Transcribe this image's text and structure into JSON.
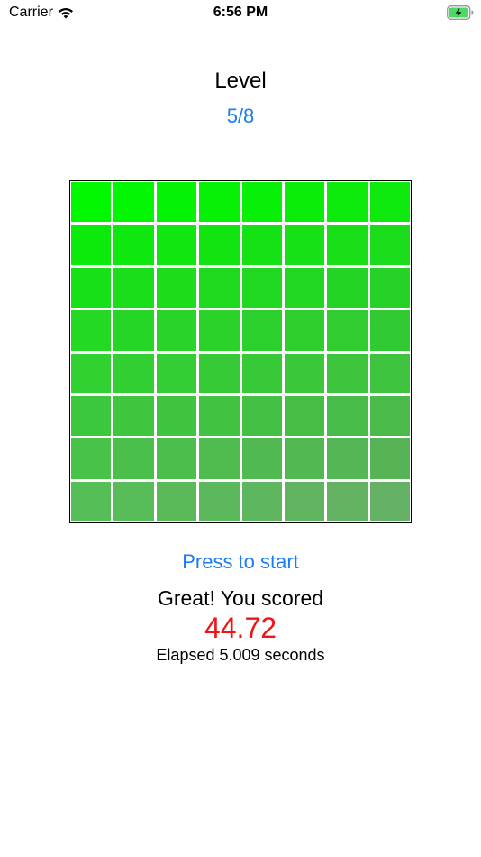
{
  "status_bar": {
    "carrier": "Carrier",
    "time": "6:56 PM",
    "battery_state": "charging"
  },
  "level": {
    "title": "Level",
    "value": "5/8"
  },
  "grid": {
    "rows": 8,
    "cols": 8,
    "colors": [
      [
        "#00f700",
        "#02f502",
        "#04f304",
        "#06f106",
        "#08ef08",
        "#0aed0a",
        "#0ceb0c",
        "#0ee90e"
      ],
      [
        "#0cea0c",
        "#0ee80e",
        "#10e610",
        "#12e412",
        "#14e214",
        "#16e016",
        "#18de18",
        "#1adc1a"
      ],
      [
        "#18e018",
        "#1ade1a",
        "#1cdc1c",
        "#1eda1e",
        "#20d820",
        "#22d622",
        "#24d424",
        "#26d226"
      ],
      [
        "#24d824",
        "#26d626",
        "#28d428",
        "#2ad22a",
        "#2cd02c",
        "#2ece2e",
        "#30cc30",
        "#32ca32"
      ],
      [
        "#30d130",
        "#32cf32",
        "#34cd34",
        "#36cb36",
        "#38c938",
        "#3ac73a",
        "#3cc53c",
        "#3ec33e"
      ],
      [
        "#3cc83c",
        "#3ec63e",
        "#40c440",
        "#42c242",
        "#44c044",
        "#46be46",
        "#48bc48",
        "#4aba4a"
      ],
      [
        "#48c248",
        "#4ac04a",
        "#4cbe4c",
        "#4ebc4e",
        "#50ba50",
        "#52b852",
        "#54b654",
        "#56b456"
      ],
      [
        "#56be56",
        "#58bc58",
        "#5aba5a",
        "#5cb85c",
        "#5eb65e",
        "#60b460",
        "#62b262",
        "#64b064"
      ]
    ]
  },
  "controls": {
    "start_label": "Press to start"
  },
  "result": {
    "message": "Great! You scored",
    "score": "44.72",
    "elapsed": "Elapsed 5.009 seconds"
  },
  "colors": {
    "accent": "#1a7cf5",
    "score": "#f01414"
  }
}
